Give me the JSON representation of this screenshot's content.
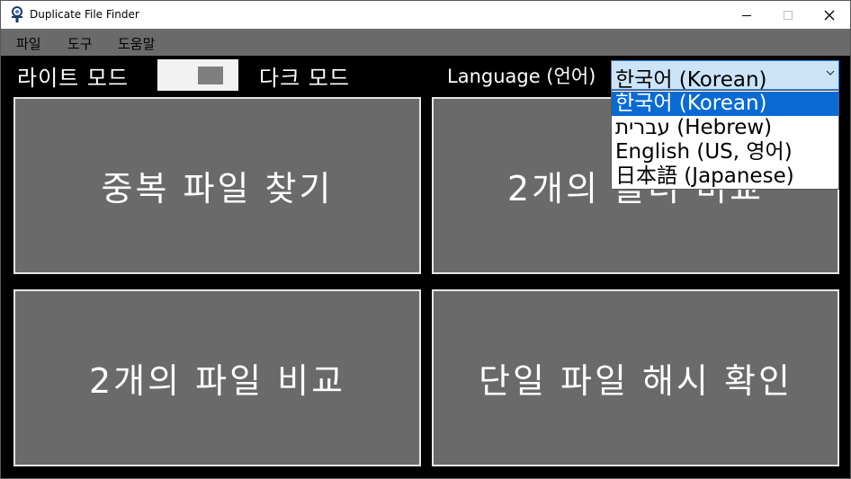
{
  "window": {
    "title": "Duplicate File Finder",
    "minimize_glyph": "—",
    "close_glyph": "✕"
  },
  "menu": {
    "items": [
      "파일",
      "도구",
      "도움말"
    ]
  },
  "toolbar": {
    "light_mode_label": "라이트 모드",
    "dark_mode_label": "다크 모드",
    "language_label": "Language (언어)",
    "selected_language": "한국어 (Korean)",
    "language_options": [
      "한국어 (Korean)",
      "עברית (Hebrew)",
      "English (US, 영어)",
      "日本語 (Japanese)"
    ]
  },
  "tiles": [
    {
      "label": "중복 파일 찾기"
    },
    {
      "label": "2개의 폴더 비교"
    },
    {
      "label": "2개의 파일 비교"
    },
    {
      "label": "단일 파일 해시 확인"
    }
  ],
  "colors": {
    "background": "#000000",
    "tile": "#6a6a6a",
    "accent": "#0a6ad4"
  }
}
